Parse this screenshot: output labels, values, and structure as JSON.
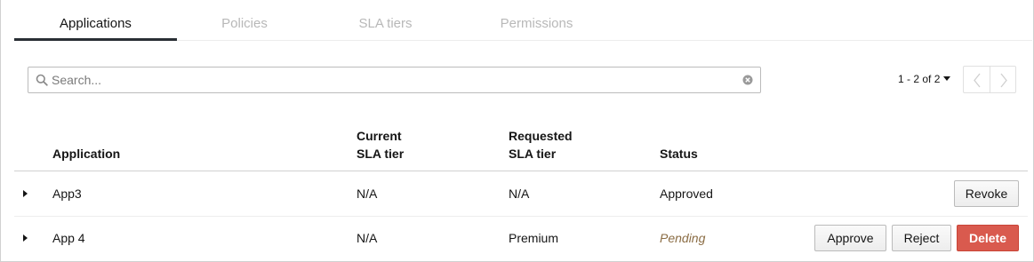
{
  "tabs": [
    {
      "label": "Applications",
      "active": true
    },
    {
      "label": "Policies",
      "active": false
    },
    {
      "label": "SLA tiers",
      "active": false
    },
    {
      "label": "Permissions",
      "active": false
    }
  ],
  "search": {
    "placeholder": "Search...",
    "value": ""
  },
  "pagination": {
    "label": "1 - 2 of 2"
  },
  "table": {
    "headers": {
      "application": "Application",
      "current_sla_line1": "Current",
      "current_sla_line2": "SLA tier",
      "requested_sla_line1": "Requested",
      "requested_sla_line2": "SLA tier",
      "status": "Status"
    },
    "rows": [
      {
        "application": "App3",
        "current_sla": "N/A",
        "requested_sla": "N/A",
        "status": "Approved",
        "actions": [
          "Revoke"
        ]
      },
      {
        "application": "App 4",
        "current_sla": "N/A",
        "requested_sla": "Premium",
        "status": "Pending",
        "actions": [
          "Approve",
          "Reject",
          "Delete"
        ]
      }
    ]
  },
  "colors": {
    "active_tab_underline": "#292e34",
    "pending_text": "#8b6d45",
    "delete_button": "#d95a4e"
  },
  "icons": [
    "search-icon",
    "clear-icon",
    "caret-down-icon",
    "chevron-left-icon",
    "chevron-right-icon",
    "expand-caret-icon"
  ]
}
